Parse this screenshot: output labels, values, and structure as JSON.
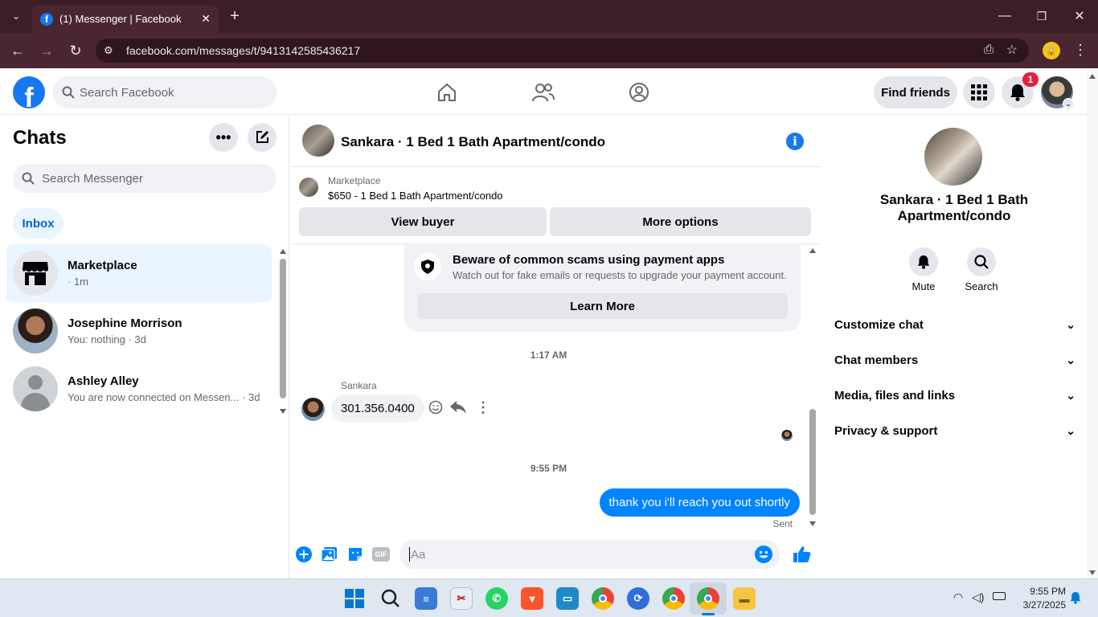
{
  "browser": {
    "tab_title": "(1) Messenger | Facebook",
    "url": "facebook.com/messages/t/9413142585436217",
    "new_tab_symbol": "+"
  },
  "header": {
    "search_placeholder": "Search Facebook",
    "find_friends": "Find friends",
    "notification_count": "1"
  },
  "left": {
    "title": "Chats",
    "search_placeholder": "Search Messenger",
    "inbox_label": "Inbox",
    "chats": [
      {
        "name": "Marketplace",
        "subtitle": "· 1m"
      },
      {
        "name": "Josephine Morrison",
        "subtitle": "You: nothing · 3d"
      },
      {
        "name": "Ashley Alley",
        "subtitle": "You are now connected on Messen... · 3d"
      }
    ]
  },
  "conversation": {
    "title": "Sankara · 1 Bed 1 Bath Apartment/condo",
    "listing_source": "Marketplace",
    "listing_title": "$650 - 1 Bed 1 Bath Apartment/condo",
    "view_buyer": "View buyer",
    "more_options": "More options",
    "warning_title": "Beware of common scams using payment apps",
    "warning_body": "Watch out for fake emails or requests to upgrade your payment account.",
    "learn_more": "Learn More",
    "time1": "1:17 AM",
    "sender": "Sankara",
    "incoming_message": "301.356.0400",
    "time2": "9:55 PM",
    "outgoing_message": "thank you i'll reach you out shortly",
    "status": "Sent",
    "composer_placeholder": "Aa",
    "gif_label": "GIF"
  },
  "right": {
    "title": "Sankara · 1 Bed 1 Bath Apartment/condo",
    "mute": "Mute",
    "search": "Search",
    "sections": [
      "Customize chat",
      "Chat members",
      "Media, files and links",
      "Privacy & support"
    ]
  },
  "taskbar": {
    "time": "9:55 PM",
    "date": "3/27/2025"
  },
  "colors": {
    "brand": "#1877f2",
    "tabbar": "#3c1e26",
    "addressbar": "#4a2630",
    "outgoing_bubble": "#0084ff",
    "notification_badge": "#e41e3f"
  }
}
